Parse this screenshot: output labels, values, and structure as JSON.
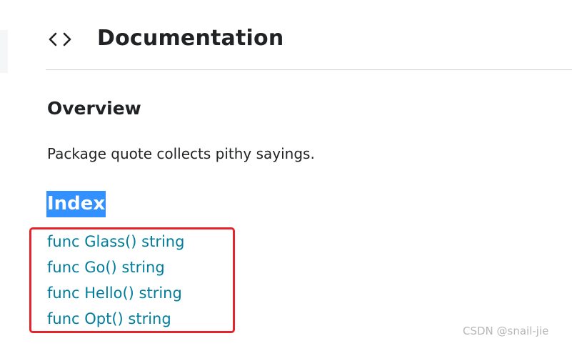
{
  "header": {
    "icon": "code-icon",
    "title": "Documentation"
  },
  "overview": {
    "title": "Overview",
    "text": "Package quote collects pithy sayings."
  },
  "index": {
    "title": "Index",
    "items": [
      {
        "label": "func Glass() string"
      },
      {
        "label": "func Go() string"
      },
      {
        "label": "func Hello() string"
      },
      {
        "label": "func Opt() string"
      }
    ]
  },
  "watermark": "CSDN @snail-jie",
  "colors": {
    "link": "#007d9c",
    "selection_highlight": "#3390ff",
    "annotation_box": "#e4232a",
    "text": "#202224"
  }
}
